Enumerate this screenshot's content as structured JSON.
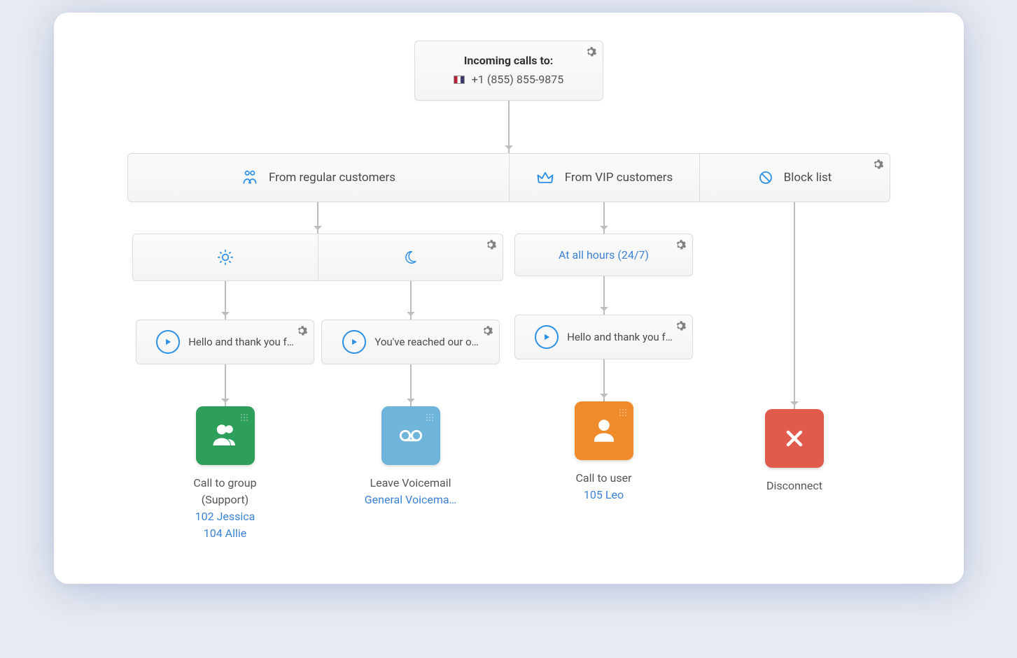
{
  "root": {
    "title": "Incoming calls to:",
    "phone": "+1 (855) 855-9875"
  },
  "branches": {
    "regular": "From regular customers",
    "vip": "From VIP customers",
    "block": "Block list"
  },
  "time": {
    "allHours": "At all hours (24/7)"
  },
  "greetings": {
    "regularDay": "Hello and thank you f…",
    "regularNight": "You've reached our o…",
    "vip": "Hello and thank you f…"
  },
  "terminals": {
    "group": {
      "title": "Call to group",
      "sub": "(Support)",
      "ext1": "102 Jessica",
      "ext2": "104 Allie"
    },
    "voicemail": {
      "title": "Leave Voicemail",
      "box": "General Voicema…"
    },
    "user": {
      "title": "Call to user",
      "ext": "105 Leo"
    },
    "disconnect": {
      "title": "Disconnect"
    }
  }
}
